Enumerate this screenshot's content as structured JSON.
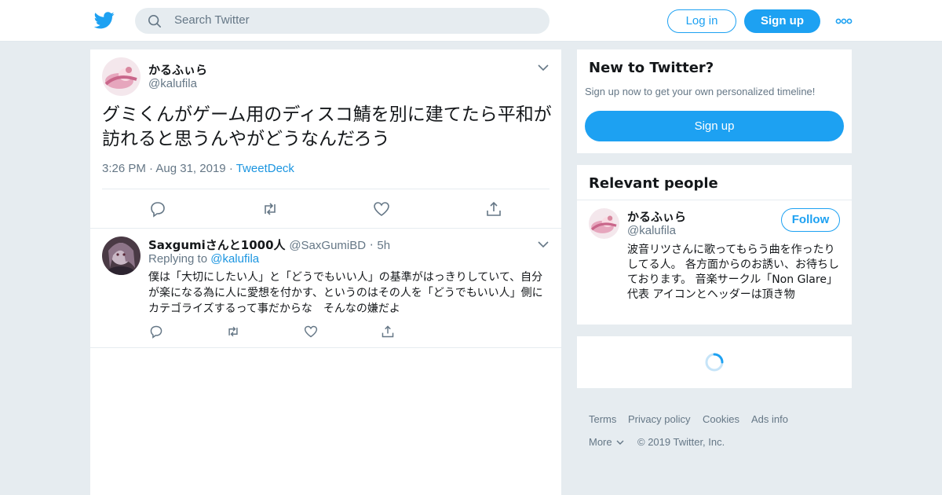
{
  "header": {
    "search_placeholder": "Search Twitter",
    "login_label": "Log in",
    "signup_label": "Sign up",
    "brand_color": "#1da1f2"
  },
  "tweet": {
    "name": "かるふぃら",
    "handle": "@kalufila",
    "text": "グミくんがゲーム用のディスコ鯖を別に建てたら平和が訪れると思うんやがどうなんだろう",
    "time": "3:26 PM",
    "date": "Aug 31, 2019",
    "source": "TweetDeck",
    "sep": "·"
  },
  "reply": {
    "name": "Saxgumiさんと1000人",
    "handle": "@SaxGumiBD",
    "age": "5h",
    "replying_label": "Replying to",
    "replying_handle": "@kalufila",
    "text": "僕は「大切にしたい人」と「どうでもいい人」の基準がはっきりしていて、自分が楽になる為に人に愛想を付かす、というのはその人を「どうでもいい人」側にカテゴライズするって事だからな　そんなの嫌だよ"
  },
  "sidebar": {
    "new_title": "New to Twitter?",
    "new_subtitle": "Sign up now to get your own personalized timeline!",
    "signup_label": "Sign up",
    "relevant_title": "Relevant people",
    "person": {
      "name": "かるふぃら",
      "handle": "@kalufila",
      "follow_label": "Follow",
      "bio": "波音リツさんに歌ってもらう曲を作ったりしてる人。 各方面からのお誘い、お待ちしております。 音楽サークル「Non Glare」代表 アイコンとヘッダーは頂き物"
    }
  },
  "footer": {
    "terms": "Terms",
    "privacy": "Privacy policy",
    "cookies": "Cookies",
    "ads": "Ads info",
    "more": "More",
    "copyright": "© 2019 Twitter, Inc."
  }
}
